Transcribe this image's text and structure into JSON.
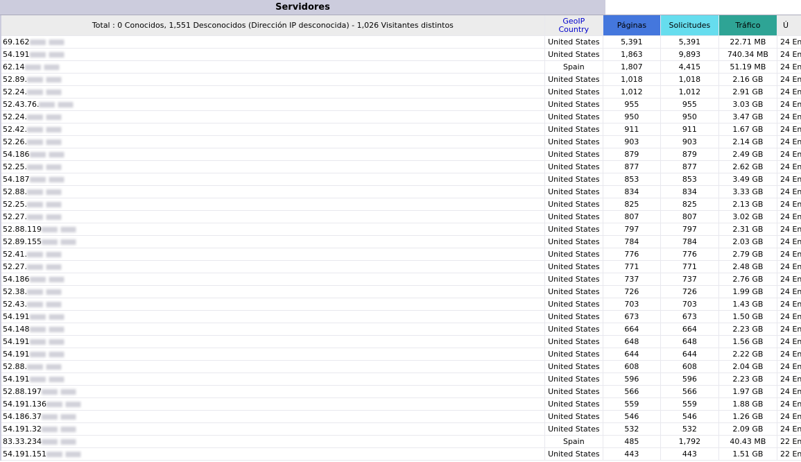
{
  "title": "Servidores",
  "header": {
    "total": "Total : 0 Conocidos, 1,551 Desconocidos (Dirección IP desconocida) - 1,026 Visitantes distintos",
    "geoip": "GeoIP",
    "country": "Country",
    "pages": "Páginas",
    "requests": "Solicitudes",
    "traffic": "Tráfico",
    "last": "Ú"
  },
  "colors": {
    "pages": "#4477dd",
    "requests": "#66ddee",
    "traffic": "#2ea495",
    "title_bar": "#ccccdd"
  },
  "rows": [
    {
      "host": "69.162",
      "country": "United States",
      "pages": "5,391",
      "requests": "5,391",
      "traffic": "22.71 MB",
      "last": "24 En"
    },
    {
      "host": "54.191",
      "country": "United States",
      "pages": "1,863",
      "requests": "9,893",
      "traffic": "740.34 MB",
      "last": "24 En"
    },
    {
      "host": "62.14",
      "country": "Spain",
      "pages": "1,807",
      "requests": "4,415",
      "traffic": "51.19 MB",
      "last": "24 En"
    },
    {
      "host": "52.89.",
      "country": "United States",
      "pages": "1,018",
      "requests": "1,018",
      "traffic": "2.16 GB",
      "last": "24 En"
    },
    {
      "host": "52.24.",
      "country": "United States",
      "pages": "1,012",
      "requests": "1,012",
      "traffic": "2.91 GB",
      "last": "24 En"
    },
    {
      "host": "52.43.76.",
      "country": "United States",
      "pages": "955",
      "requests": "955",
      "traffic": "3.03 GB",
      "last": "24 En"
    },
    {
      "host": "52.24.",
      "country": "United States",
      "pages": "950",
      "requests": "950",
      "traffic": "3.47 GB",
      "last": "24 En"
    },
    {
      "host": "52.42.",
      "country": "United States",
      "pages": "911",
      "requests": "911",
      "traffic": "1.67 GB",
      "last": "24 En"
    },
    {
      "host": "52.26.",
      "country": "United States",
      "pages": "903",
      "requests": "903",
      "traffic": "2.14 GB",
      "last": "24 En"
    },
    {
      "host": "54.186",
      "country": "United States",
      "pages": "879",
      "requests": "879",
      "traffic": "2.49 GB",
      "last": "24 En"
    },
    {
      "host": "52.25.",
      "country": "United States",
      "pages": "877",
      "requests": "877",
      "traffic": "2.62 GB",
      "last": "24 En"
    },
    {
      "host": "54.187",
      "country": "United States",
      "pages": "853",
      "requests": "853",
      "traffic": "3.49 GB",
      "last": "24 En"
    },
    {
      "host": "52.88.",
      "country": "United States",
      "pages": "834",
      "requests": "834",
      "traffic": "3.33 GB",
      "last": "24 En"
    },
    {
      "host": "52.25.",
      "country": "United States",
      "pages": "825",
      "requests": "825",
      "traffic": "2.13 GB",
      "last": "24 En"
    },
    {
      "host": "52.27.",
      "country": "United States",
      "pages": "807",
      "requests": "807",
      "traffic": "3.02 GB",
      "last": "24 En"
    },
    {
      "host": "52.88.119",
      "country": "United States",
      "pages": "797",
      "requests": "797",
      "traffic": "2.31 GB",
      "last": "24 En"
    },
    {
      "host": "52.89.155",
      "country": "United States",
      "pages": "784",
      "requests": "784",
      "traffic": "2.03 GB",
      "last": "24 En"
    },
    {
      "host": "52.41.",
      "country": "United States",
      "pages": "776",
      "requests": "776",
      "traffic": "2.79 GB",
      "last": "24 En"
    },
    {
      "host": "52.27.",
      "country": "United States",
      "pages": "771",
      "requests": "771",
      "traffic": "2.48 GB",
      "last": "24 En"
    },
    {
      "host": "54.186",
      "country": "United States",
      "pages": "737",
      "requests": "737",
      "traffic": "2.76 GB",
      "last": "24 En"
    },
    {
      "host": "52.38.",
      "country": "United States",
      "pages": "726",
      "requests": "726",
      "traffic": "1.99 GB",
      "last": "24 En"
    },
    {
      "host": "52.43.",
      "country": "United States",
      "pages": "703",
      "requests": "703",
      "traffic": "1.43 GB",
      "last": "24 En"
    },
    {
      "host": "54.191",
      "country": "United States",
      "pages": "673",
      "requests": "673",
      "traffic": "1.50 GB",
      "last": "24 En"
    },
    {
      "host": "54.148",
      "country": "United States",
      "pages": "664",
      "requests": "664",
      "traffic": "2.23 GB",
      "last": "24 En"
    },
    {
      "host": "54.191",
      "country": "United States",
      "pages": "648",
      "requests": "648",
      "traffic": "1.56 GB",
      "last": "24 En"
    },
    {
      "host": "54.191",
      "country": "United States",
      "pages": "644",
      "requests": "644",
      "traffic": "2.22 GB",
      "last": "24 En"
    },
    {
      "host": "52.88.",
      "country": "United States",
      "pages": "608",
      "requests": "608",
      "traffic": "2.04 GB",
      "last": "24 En"
    },
    {
      "host": "54.191",
      "country": "United States",
      "pages": "596",
      "requests": "596",
      "traffic": "2.23 GB",
      "last": "24 En"
    },
    {
      "host": "52.88.197",
      "country": "United States",
      "pages": "566",
      "requests": "566",
      "traffic": "1.97 GB",
      "last": "24 En"
    },
    {
      "host": "54.191.136",
      "country": "United States",
      "pages": "559",
      "requests": "559",
      "traffic": "1.88 GB",
      "last": "24 En"
    },
    {
      "host": "54.186.37",
      "country": "United States",
      "pages": "546",
      "requests": "546",
      "traffic": "1.26 GB",
      "last": "24 En"
    },
    {
      "host": "54.191.32",
      "country": "United States",
      "pages": "532",
      "requests": "532",
      "traffic": "2.09 GB",
      "last": "24 En"
    },
    {
      "host": "83.33.234",
      "country": "Spain",
      "pages": "485",
      "requests": "1,792",
      "traffic": "40.43 MB",
      "last": "22 En"
    },
    {
      "host": "54.191.151",
      "country": "United States",
      "pages": "443",
      "requests": "443",
      "traffic": "1.51 GB",
      "last": "22 En"
    }
  ]
}
